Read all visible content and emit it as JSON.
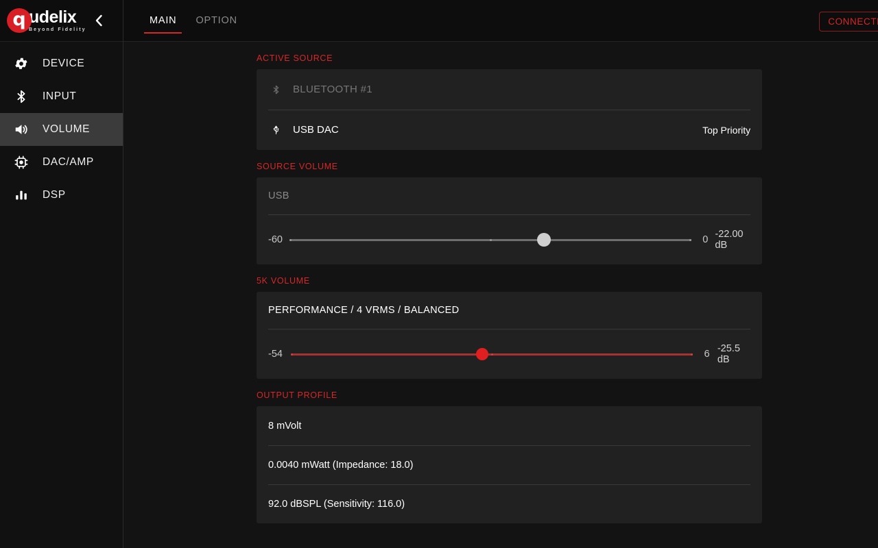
{
  "brand": {
    "mark_letter": "q",
    "word": "udelix",
    "tagline": "Beyond Fidelity",
    "collapse_glyph": "‹",
    "accent_color": "#d62828",
    "logo_color": "#d81f26"
  },
  "sidebar": {
    "items": [
      {
        "label": "DEVICE",
        "icon": "gear-icon",
        "active": false
      },
      {
        "label": "INPUT",
        "icon": "bluetooth-icon",
        "active": false
      },
      {
        "label": "VOLUME",
        "icon": "speaker-icon",
        "active": true
      },
      {
        "label": "DAC/AMP",
        "icon": "chip-icon",
        "active": false
      },
      {
        "label": "DSP",
        "icon": "bars-icon",
        "active": false
      }
    ]
  },
  "topbar": {
    "tabs": [
      {
        "label": "MAIN",
        "active": true
      },
      {
        "label": "OPTION",
        "active": false
      }
    ],
    "status": "CONNECTED"
  },
  "active_source": {
    "title": "ACTIVE SOURCE",
    "rows": [
      {
        "label": "BLUETOOTH #1",
        "icon": "bluetooth-icon",
        "right": "",
        "dim": true
      },
      {
        "label": "USB DAC",
        "icon": "usb-icon",
        "right": "Top Priority",
        "dim": false
      }
    ]
  },
  "source_volume": {
    "title": "SOURCE VOLUME",
    "name": "USB",
    "min": "-60",
    "max": "0",
    "value": "-22.00 dB",
    "min_num": -60,
    "max_num": 0,
    "value_num": -22.0,
    "color": "#6e6e6e",
    "thumb_color": "#cfcfcf"
  },
  "device_volume": {
    "title": "5K VOLUME",
    "name": "PERFORMANCE / 4 VRMS / BALANCED",
    "min": "-54",
    "max": "6",
    "value": "-25.5 dB",
    "min_num": -54,
    "max_num": 6,
    "value_num": -25.5,
    "color": "#a83232",
    "thumb_color": "#e02020"
  },
  "output_profile": {
    "title": "OUTPUT PROFILE",
    "rows": [
      "8 mVolt",
      "0.0040 mWatt (Impedance: 18.0)",
      "92.0 dBSPL (Sensitivity: 116.0)"
    ]
  }
}
